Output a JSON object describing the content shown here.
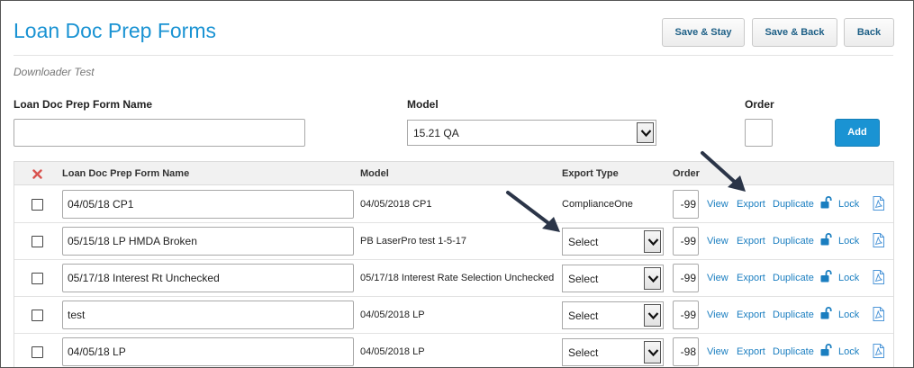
{
  "header": {
    "title": "Loan Doc Prep Forms",
    "save_stay": "Save & Stay",
    "save_back": "Save & Back",
    "back": "Back"
  },
  "subtitle": "Downloader Test",
  "form": {
    "name_label": "Loan Doc Prep Form Name",
    "name_value": "",
    "model_label": "Model",
    "model_value": "15.21 QA",
    "order_label": "Order",
    "order_value": "",
    "add_label": "Add"
  },
  "table": {
    "columns": {
      "name": "Loan Doc Prep Form Name",
      "model": "Model",
      "export_type": "Export Type",
      "order": "Order"
    },
    "action_labels": {
      "view": "View",
      "export": "Export",
      "duplicate": "Duplicate",
      "lock": "Lock"
    },
    "rows": [
      {
        "name": "04/05/18 CP1",
        "model": "04/05/2018 CP1",
        "export_type": "ComplianceOne",
        "order": "-99"
      },
      {
        "name": "05/15/18 LP HMDA Broken",
        "model": "PB LaserPro test 1-5-17",
        "export_type": "Select",
        "order": "-99"
      },
      {
        "name": "05/17/18 Interest Rt Unchecked",
        "model": "05/17/18 Interest Rate Selection Unchecked",
        "export_type": "Select",
        "order": "-99"
      },
      {
        "name": "test",
        "model": "04/05/2018 LP",
        "export_type": "Select",
        "order": "-99"
      },
      {
        "name": "04/05/18 LP",
        "model": "04/05/2018 LP",
        "export_type": "Select",
        "order": "-98"
      }
    ]
  },
  "colors": {
    "accent": "#1a93d3",
    "link": "#1a7ec0",
    "delete": "#d9534f",
    "arrow": "#2b3548"
  },
  "icons": [
    "delete-x-icon",
    "chevron-down-icon",
    "unlock-icon",
    "pdf-icon",
    "arrow-annotation"
  ]
}
